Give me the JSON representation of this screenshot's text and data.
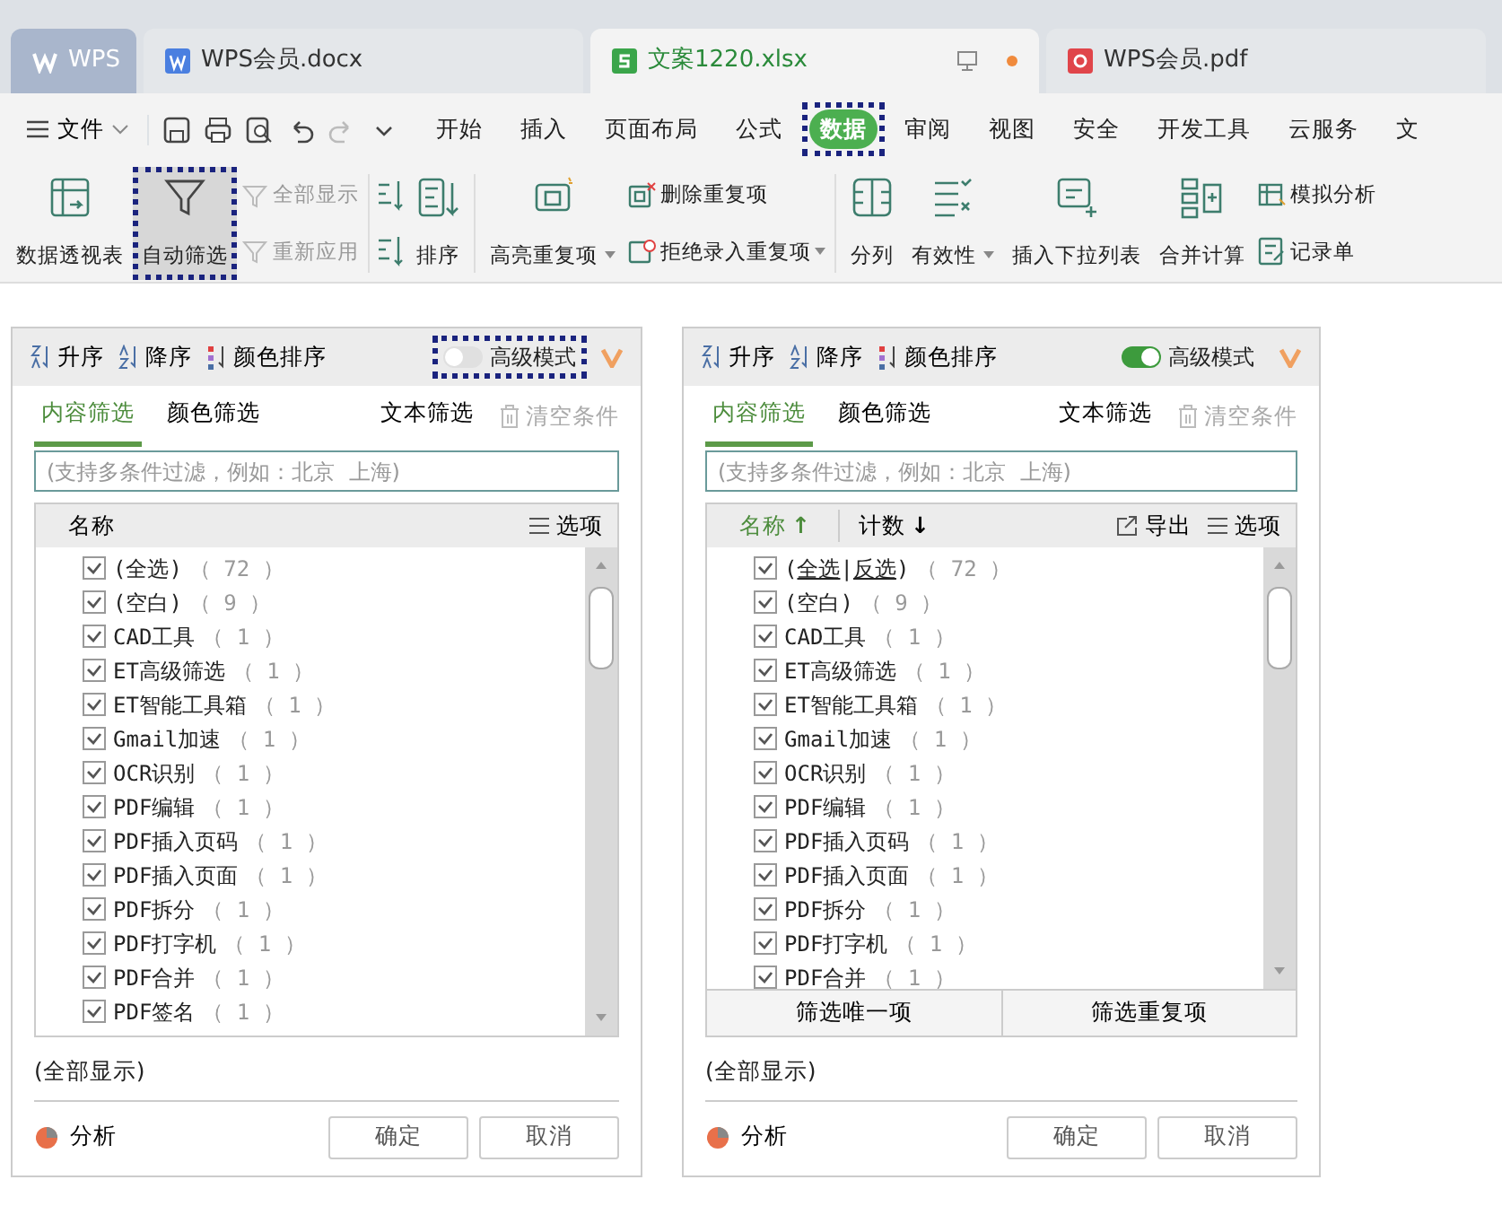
{
  "doc_tabs": [
    {
      "kind": "home",
      "label": "WPS",
      "selected": false
    },
    {
      "kind": "doc",
      "label": "WPS会员.docx",
      "selected": false
    },
    {
      "kind": "sheet",
      "label": "文案1220.xlsx",
      "selected": true
    },
    {
      "kind": "pdf",
      "label": "WPS会员.pdf",
      "selected": false
    }
  ],
  "menu": {
    "file": "文件",
    "ribbon_tabs": [
      {
        "label": "开始",
        "selected": false,
        "highlighted": false
      },
      {
        "label": "插入",
        "selected": false,
        "highlighted": false
      },
      {
        "label": "页面布局",
        "selected": false,
        "highlighted": false
      },
      {
        "label": "公式",
        "selected": false,
        "highlighted": false
      },
      {
        "label": "数据",
        "selected": true,
        "highlighted": true
      },
      {
        "label": "审阅",
        "selected": false,
        "highlighted": false
      },
      {
        "label": "视图",
        "selected": false,
        "highlighted": false
      },
      {
        "label": "安全",
        "selected": false,
        "highlighted": false
      },
      {
        "label": "开发工具",
        "selected": false,
        "highlighted": false
      },
      {
        "label": "云服务",
        "selected": false,
        "highlighted": false
      },
      {
        "label": "文",
        "selected": false,
        "highlighted": false
      }
    ]
  },
  "ribbon": [
    {
      "kind": "large",
      "label": "数据透视表",
      "dropdown": false,
      "selected": false,
      "highlighted": false
    },
    {
      "kind": "large",
      "label": "自动筛选",
      "dropdown": false,
      "selected": true,
      "highlighted": true
    },
    {
      "kind": "stack",
      "items": [
        {
          "label": "全部显示",
          "disabled": true,
          "dropdown": false
        },
        {
          "label": "重新应用",
          "disabled": true,
          "dropdown": false
        }
      ]
    },
    {
      "kind": "sep"
    },
    {
      "kind": "sorticons"
    },
    {
      "kind": "large",
      "label": "排序",
      "dropdown": false,
      "selected": false,
      "highlighted": false
    },
    {
      "kind": "sep"
    },
    {
      "kind": "large",
      "label": "高亮重复项",
      "dropdown": true,
      "selected": false,
      "highlighted": false
    },
    {
      "kind": "stack",
      "items": [
        {
          "label": "删除重复项",
          "disabled": false,
          "dropdown": false
        },
        {
          "label": "拒绝录入重复项",
          "disabled": false,
          "dropdown": true
        }
      ]
    },
    {
      "kind": "sep"
    },
    {
      "kind": "large",
      "label": "分列",
      "dropdown": false,
      "selected": false,
      "highlighted": false
    },
    {
      "kind": "large",
      "label": "有效性",
      "dropdown": true,
      "selected": false,
      "highlighted": false
    },
    {
      "kind": "large",
      "label": "插入下拉列表",
      "dropdown": false,
      "selected": false,
      "highlighted": false
    },
    {
      "kind": "large",
      "label": "合并计算",
      "dropdown": false,
      "selected": false,
      "highlighted": false
    },
    {
      "kind": "stack",
      "items": [
        {
          "label": "模拟分析",
          "disabled": false,
          "dropdown": false
        },
        {
          "label": "记录单",
          "disabled": false,
          "dropdown": false
        }
      ]
    }
  ],
  "panels": [
    {
      "sort_buttons": [
        "升序",
        "降序",
        "颜色排序"
      ],
      "advanced": {
        "label": "高级模式",
        "on": false,
        "highlighted": true
      },
      "filter_tabs": [
        {
          "label": "内容筛选",
          "selected": true
        },
        {
          "label": "颜色筛选",
          "selected": false
        }
      ],
      "text_filter": "文本筛选",
      "clear": {
        "label": "清空条件",
        "disabled": true
      },
      "search": {
        "placeholder": "(支持多条件过滤，例如：北京  上海)"
      },
      "columns": [
        {
          "label": "名称",
          "active": false
        }
      ],
      "tools": [
        {
          "kind": "options",
          "label": "选项"
        }
      ],
      "items": [
        {
          "name": "(全选)",
          "count": "（ 72 ）",
          "checked": true
        },
        {
          "name": "(空白)",
          "count": "（ 9 ）",
          "checked": true
        },
        {
          "name": "CAD工具",
          "count": "（ 1 ）",
          "checked": true
        },
        {
          "name": "ET高级筛选",
          "count": "（ 1 ）",
          "checked": true
        },
        {
          "name": "ET智能工具箱",
          "count": "（ 1 ）",
          "checked": true
        },
        {
          "name": "Gmail加速",
          "count": "（ 1 ）",
          "checked": true
        },
        {
          "name": "OCR识别",
          "count": "（ 1 ）",
          "checked": true
        },
        {
          "name": "PDF编辑",
          "count": "（ 1 ）",
          "checked": true
        },
        {
          "name": "PDF插入页码",
          "count": "（ 1 ）",
          "checked": true
        },
        {
          "name": "PDF插入页面",
          "count": "（ 1 ）",
          "checked": true
        },
        {
          "name": "PDF拆分",
          "count": "（ 1 ）",
          "checked": true
        },
        {
          "name": "PDF打字机",
          "count": "（ 1 ）",
          "checked": true
        },
        {
          "name": "PDF合并",
          "count": "（ 1 ）",
          "checked": true
        },
        {
          "name": "PDF签名",
          "count": "（ 1 ）",
          "checked": true
        }
      ],
      "summary": "(全部显示)",
      "analyze": "分析",
      "buttons": [
        "确定",
        "取消"
      ]
    },
    {
      "sort_buttons": [
        "升序",
        "降序",
        "颜色排序"
      ],
      "advanced": {
        "label": "高级模式",
        "on": true,
        "highlighted": false
      },
      "filter_tabs": [
        {
          "label": "内容筛选",
          "selected": true
        },
        {
          "label": "颜色筛选",
          "selected": false
        }
      ],
      "text_filter": "文本筛选",
      "clear": {
        "label": "清空条件",
        "disabled": true
      },
      "search": {
        "placeholder": "(支持多条件过滤，例如：北京  上海)"
      },
      "columns": [
        {
          "label": "名称",
          "arrow": "↑",
          "active": true
        },
        {
          "label": "计数",
          "arrow": "↓",
          "active": false
        }
      ],
      "tools": [
        {
          "kind": "export",
          "label": "导出"
        },
        {
          "kind": "options",
          "label": "选项"
        }
      ],
      "items": [
        {
          "parts": [
            {
              "text": "(",
              "link": false
            },
            {
              "text": "全选",
              "link": true
            },
            {
              "text": "|",
              "link": false
            },
            {
              "text": "反选",
              "link": true
            },
            {
              "text": ")",
              "link": false
            }
          ],
          "count": "（ 72 ）",
          "checked": true
        },
        {
          "name": "(空白)",
          "count": "（ 9 ）",
          "checked": true
        },
        {
          "name": "CAD工具",
          "count": "（ 1 ）",
          "checked": true
        },
        {
          "name": "ET高级筛选",
          "count": "（ 1 ）",
          "checked": true
        },
        {
          "name": "ET智能工具箱",
          "count": "（ 1 ）",
          "checked": true
        },
        {
          "name": "Gmail加速",
          "count": "（ 1 ）",
          "checked": true
        },
        {
          "name": "OCR识别",
          "count": "（ 1 ）",
          "checked": true
        },
        {
          "name": "PDF编辑",
          "count": "（ 1 ）",
          "checked": true
        },
        {
          "name": "PDF插入页码",
          "count": "（ 1 ）",
          "checked": true
        },
        {
          "name": "PDF插入页面",
          "count": "（ 1 ）",
          "checked": true
        },
        {
          "name": "PDF拆分",
          "count": "（ 1 ）",
          "checked": true
        },
        {
          "name": "PDF打字机",
          "count": "（ 1 ）",
          "checked": true
        },
        {
          "name": "PDF合并",
          "count": "（ 1 ）",
          "checked": true
        }
      ],
      "list_buttons": [
        "筛选唯一项",
        "筛选重复项"
      ],
      "summary": "(全部显示)",
      "analyze": "分析",
      "buttons": [
        "确定",
        "取消"
      ]
    }
  ]
}
